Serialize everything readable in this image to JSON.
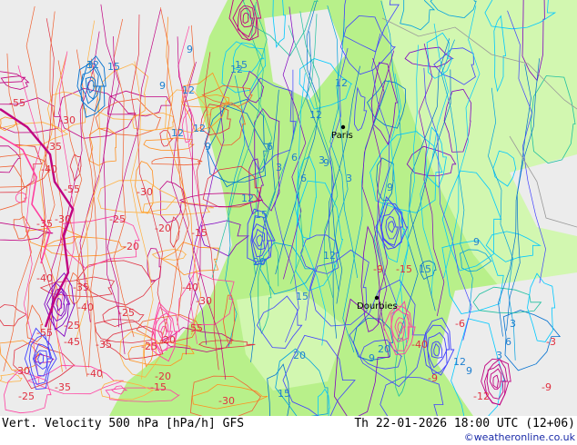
{
  "footer": {
    "left": "Vert. Velocity 500 hPa [hPa/h] GFS",
    "right": "Th 22-01-2026 18:00 UTC (12+06)",
    "credit": "©weatheronline.co.uk"
  },
  "cities": [
    {
      "name": "Paris"
    },
    {
      "name": "Dourbies"
    }
  ],
  "contour_labels": [
    "12",
    "15",
    "12",
    "9",
    "12",
    "9",
    "15",
    "12",
    "12",
    "9",
    "12",
    "12",
    "6",
    "3",
    "6",
    "9",
    "12",
    "15",
    "20",
    "15",
    "20",
    "15",
    "20",
    "9",
    "12",
    "3",
    "6",
    "3",
    "9",
    "15",
    "9",
    "12",
    "9",
    "3",
    "6",
    "3",
    "-55",
    "-30",
    "-40",
    "-35",
    "-55",
    "-30",
    "-35",
    "-30",
    "-25",
    "-20",
    "-15",
    "-20",
    "-40",
    "-35",
    "-40",
    "-30",
    "-25",
    "-55",
    "-45",
    "-35",
    "-30",
    "-25",
    "-40",
    "-25",
    "-55",
    "-40",
    "-20",
    "-15",
    "-9",
    "-15",
    "-40",
    "-30",
    "-35",
    "-25",
    "-20",
    "-9",
    "-12",
    "-9",
    "-3",
    "-6",
    "3"
  ],
  "colors": {
    "land": "#b8f08a",
    "land_light": "#d2f7b0",
    "sea_grey": "#ececec",
    "positive_contours": "#00a0e0",
    "negative_contours": "#e03040"
  }
}
